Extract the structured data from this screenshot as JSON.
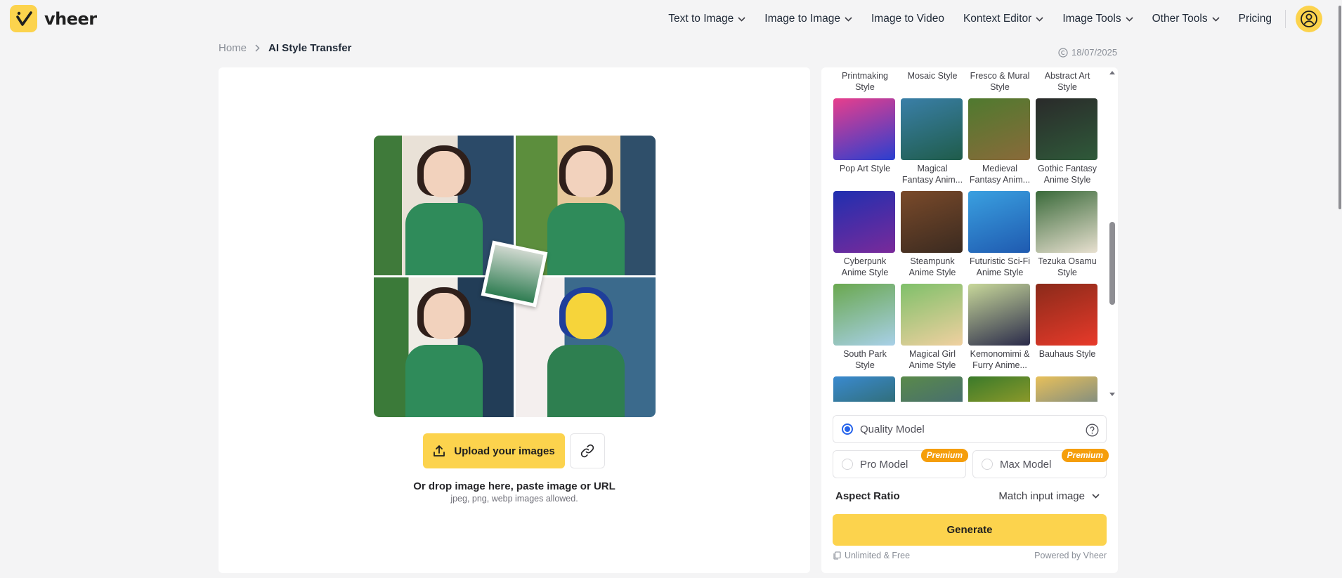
{
  "brand": {
    "name": "vheer",
    "accent": "#fcd34d"
  },
  "nav": {
    "items": [
      {
        "label": "Text to Image",
        "dropdown": true
      },
      {
        "label": "Image to Image",
        "dropdown": true
      },
      {
        "label": "Image to Video",
        "dropdown": false
      },
      {
        "label": "Kontext Editor",
        "dropdown": true
      },
      {
        "label": "Image Tools",
        "dropdown": true
      },
      {
        "label": "Other Tools",
        "dropdown": true
      },
      {
        "label": "Pricing",
        "dropdown": false
      }
    ]
  },
  "breadcrumb": {
    "home": "Home",
    "current": "AI Style Transfer"
  },
  "date": "18/07/2025",
  "upload": {
    "button_label": "Upload your images",
    "drop_text": "Or drop image here, paste image or URL",
    "formats": "jpeg, png, webp images allowed."
  },
  "styles": {
    "items": [
      {
        "label": "Printmaking Style",
        "colors": [
          "#c9c4b8",
          "#6b6257"
        ]
      },
      {
        "label": "Mosaic Style",
        "colors": [
          "#c9b894",
          "#5f7d8c"
        ]
      },
      {
        "label": "Fresco & Mural Style",
        "colors": [
          "#c7a77a",
          "#8a5a3b"
        ]
      },
      {
        "label": "Abstract Art Style",
        "colors": [
          "#7a8fb0",
          "#c25a3a"
        ]
      },
      {
        "label": "Pop Art Style",
        "colors": [
          "#e83e8c",
          "#2a3fd0"
        ]
      },
      {
        "label": "Magical Fantasy Anim...",
        "colors": [
          "#3a7fa8",
          "#1f5c4a"
        ]
      },
      {
        "label": "Medieval Fantasy Anim...",
        "colors": [
          "#4f7a2f",
          "#8a6a3a"
        ]
      },
      {
        "label": "Gothic Fantasy Anime Style",
        "colors": [
          "#2a2a2a",
          "#2f5a3a"
        ]
      },
      {
        "label": "Cyberpunk Anime Style",
        "colors": [
          "#1f2fb0",
          "#7a2a9a"
        ]
      },
      {
        "label": "Steampunk Anime Style",
        "colors": [
          "#7a4a2a",
          "#3a2a20"
        ]
      },
      {
        "label": "Futuristic Sci-Fi Anime Style",
        "colors": [
          "#3aa0e0",
          "#1f5ab0"
        ]
      },
      {
        "label": "Tezuka Osamu Style",
        "colors": [
          "#3a6a3a",
          "#e8e0d0"
        ]
      },
      {
        "label": "South Park Style",
        "colors": [
          "#6aa84f",
          "#a8d0e8"
        ]
      },
      {
        "label": "Magical Girl Anime Style",
        "colors": [
          "#7fc06a",
          "#f0d0a0"
        ]
      },
      {
        "label": "Kemonomimi & Furry Anime...",
        "colors": [
          "#c8d89a",
          "#2a2a4a"
        ]
      },
      {
        "label": "Bauhaus Style",
        "colors": [
          "#8a2a1a",
          "#e83a2a"
        ]
      },
      {
        "label": "",
        "colors": [
          "#3a8ad0",
          "#2a5a3a"
        ]
      },
      {
        "label": "",
        "colors": [
          "#5a8a4a",
          "#3a5a8a"
        ]
      },
      {
        "label": "",
        "colors": [
          "#3a7a2a",
          "#c8b02a"
        ]
      },
      {
        "label": "",
        "colors": [
          "#e8c05a",
          "#3a6a9a"
        ]
      }
    ]
  },
  "models": {
    "quality": "Quality Model",
    "pro": "Pro Model",
    "max": "Max Model",
    "premium_badge": "Premium"
  },
  "aspect": {
    "label": "Aspect Ratio",
    "value": "Match input image"
  },
  "generate_label": "Generate",
  "footer": {
    "left": "Unlimited & Free",
    "right": "Powered by Vheer"
  }
}
